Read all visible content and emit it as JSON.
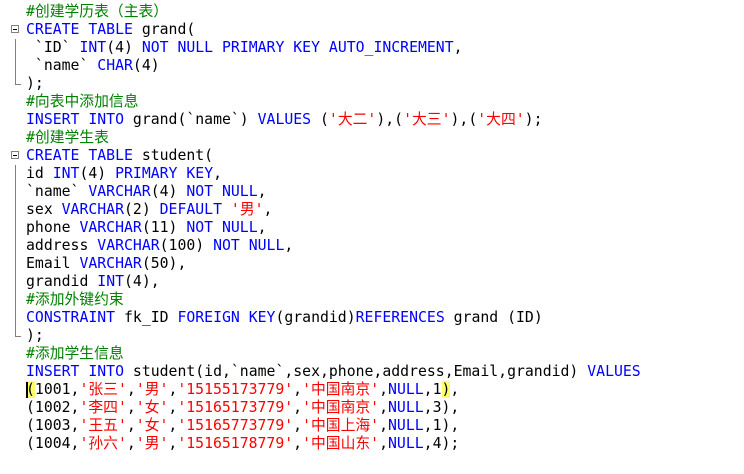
{
  "editor": {
    "language": "SQL",
    "colors": {
      "keyword": "#0000ff",
      "string": "#ff0000",
      "comment": "#008000",
      "text": "#000000"
    },
    "lines": [
      {
        "fold": "",
        "tokens": [
          {
            "t": "cmt",
            "v": "#创建学历表（主表）"
          }
        ]
      },
      {
        "fold": "start",
        "tokens": [
          {
            "t": "kw",
            "v": "CREATE TABLE"
          },
          {
            "t": "pl",
            "v": " grand("
          }
        ]
      },
      {
        "fold": "bar",
        "tokens": [
          {
            "t": "pl",
            "v": " `ID` "
          },
          {
            "t": "kw",
            "v": "INT"
          },
          {
            "t": "pl",
            "v": "(4) "
          },
          {
            "t": "kw",
            "v": "NOT NULL PRIMARY KEY AUTO_INCREMENT"
          },
          {
            "t": "pl",
            "v": ","
          }
        ]
      },
      {
        "fold": "bar",
        "tokens": [
          {
            "t": "pl",
            "v": " `name` "
          },
          {
            "t": "kw",
            "v": "CHAR"
          },
          {
            "t": "pl",
            "v": "(4)"
          }
        ]
      },
      {
        "fold": "end",
        "tokens": [
          {
            "t": "pl",
            "v": ");"
          }
        ]
      },
      {
        "fold": "",
        "tokens": [
          {
            "t": "cmt",
            "v": "#向表中添加信息"
          }
        ]
      },
      {
        "fold": "",
        "tokens": [
          {
            "t": "kw",
            "v": "INSERT INTO"
          },
          {
            "t": "pl",
            "v": " grand(`name`) "
          },
          {
            "t": "kw",
            "v": "VALUES"
          },
          {
            "t": "pl",
            "v": " ("
          },
          {
            "t": "str",
            "v": "'大二'"
          },
          {
            "t": "pl",
            "v": "),("
          },
          {
            "t": "str",
            "v": "'大三'"
          },
          {
            "t": "pl",
            "v": "),("
          },
          {
            "t": "str",
            "v": "'大四'"
          },
          {
            "t": "pl",
            "v": ");"
          }
        ]
      },
      {
        "fold": "",
        "tokens": [
          {
            "t": "cmt",
            "v": "#创建学生表"
          }
        ]
      },
      {
        "fold": "start",
        "tokens": [
          {
            "t": "kw",
            "v": "CREATE TABLE"
          },
          {
            "t": "pl",
            "v": " student("
          }
        ]
      },
      {
        "fold": "bar",
        "tokens": [
          {
            "t": "pl",
            "v": "id "
          },
          {
            "t": "kw",
            "v": "INT"
          },
          {
            "t": "pl",
            "v": "(4) "
          },
          {
            "t": "kw",
            "v": "PRIMARY KEY"
          },
          {
            "t": "pl",
            "v": ","
          }
        ]
      },
      {
        "fold": "bar",
        "tokens": [
          {
            "t": "pl",
            "v": "`name` "
          },
          {
            "t": "kw",
            "v": "VARCHAR"
          },
          {
            "t": "pl",
            "v": "(4) "
          },
          {
            "t": "kw",
            "v": "NOT NULL"
          },
          {
            "t": "pl",
            "v": ","
          }
        ]
      },
      {
        "fold": "bar",
        "tokens": [
          {
            "t": "pl",
            "v": "sex "
          },
          {
            "t": "kw",
            "v": "VARCHAR"
          },
          {
            "t": "pl",
            "v": "(2) "
          },
          {
            "t": "kw",
            "v": "DEFAULT"
          },
          {
            "t": "pl",
            "v": " "
          },
          {
            "t": "str",
            "v": "'男'"
          },
          {
            "t": "pl",
            "v": ","
          }
        ]
      },
      {
        "fold": "bar",
        "tokens": [
          {
            "t": "pl",
            "v": "phone "
          },
          {
            "t": "kw",
            "v": "VARCHAR"
          },
          {
            "t": "pl",
            "v": "(11) "
          },
          {
            "t": "kw",
            "v": "NOT NULL"
          },
          {
            "t": "pl",
            "v": ","
          }
        ]
      },
      {
        "fold": "bar",
        "tokens": [
          {
            "t": "pl",
            "v": "address "
          },
          {
            "t": "kw",
            "v": "VARCHAR"
          },
          {
            "t": "pl",
            "v": "(100) "
          },
          {
            "t": "kw",
            "v": "NOT NULL"
          },
          {
            "t": "pl",
            "v": ","
          }
        ]
      },
      {
        "fold": "bar",
        "tokens": [
          {
            "t": "pl",
            "v": "Email "
          },
          {
            "t": "kw",
            "v": "VARCHAR"
          },
          {
            "t": "pl",
            "v": "(50),"
          }
        ]
      },
      {
        "fold": "bar",
        "tokens": [
          {
            "t": "pl",
            "v": "grandid "
          },
          {
            "t": "kw",
            "v": "INT"
          },
          {
            "t": "pl",
            "v": "(4),"
          }
        ]
      },
      {
        "fold": "bar",
        "tokens": [
          {
            "t": "cmt",
            "v": "#添加外键约束"
          }
        ]
      },
      {
        "fold": "bar",
        "tokens": [
          {
            "t": "kw",
            "v": "CONSTRAINT"
          },
          {
            "t": "pl",
            "v": " fk_ID "
          },
          {
            "t": "kw",
            "v": "FOREIGN KEY"
          },
          {
            "t": "pl",
            "v": "(grandid)"
          },
          {
            "t": "kw",
            "v": "REFERENCES"
          },
          {
            "t": "pl",
            "v": " grand (ID)"
          }
        ]
      },
      {
        "fold": "end",
        "tokens": [
          {
            "t": "pl",
            "v": ");"
          }
        ]
      },
      {
        "fold": "",
        "tokens": [
          {
            "t": "cmt",
            "v": "#添加学生信息"
          }
        ]
      },
      {
        "fold": "",
        "tokens": [
          {
            "t": "kw",
            "v": "INSERT INTO"
          },
          {
            "t": "pl",
            "v": " student(id,`name`,sex,phone,address,Email,grandid) "
          },
          {
            "t": "kw",
            "v": "VALUES"
          }
        ]
      },
      {
        "fold": "",
        "tokens": [
          {
            "t": "hl",
            "v": "("
          },
          {
            "t": "pl",
            "v": "1001,"
          },
          {
            "t": "str",
            "v": "'张三'"
          },
          {
            "t": "pl",
            "v": ","
          },
          {
            "t": "str",
            "v": "'男'"
          },
          {
            "t": "pl",
            "v": ","
          },
          {
            "t": "str",
            "v": "'15155173779'"
          },
          {
            "t": "pl",
            "v": ","
          },
          {
            "t": "str",
            "v": "'中国南京'"
          },
          {
            "t": "pl",
            "v": ","
          },
          {
            "t": "kw",
            "v": "NULL"
          },
          {
            "t": "pl",
            "v": ",1"
          },
          {
            "t": "hl",
            "v": ")"
          },
          {
            "t": "pl",
            "v": ","
          }
        ]
      },
      {
        "fold": "",
        "tokens": [
          {
            "t": "pl",
            "v": "(1002,"
          },
          {
            "t": "str",
            "v": "'李四'"
          },
          {
            "t": "pl",
            "v": ","
          },
          {
            "t": "str",
            "v": "'女'"
          },
          {
            "t": "pl",
            "v": ","
          },
          {
            "t": "str",
            "v": "'15165173779'"
          },
          {
            "t": "pl",
            "v": ","
          },
          {
            "t": "str",
            "v": "'中国南京'"
          },
          {
            "t": "pl",
            "v": ","
          },
          {
            "t": "kw",
            "v": "NULL"
          },
          {
            "t": "pl",
            "v": ",3),"
          }
        ]
      },
      {
        "fold": "",
        "tokens": [
          {
            "t": "pl",
            "v": "(1003,"
          },
          {
            "t": "str",
            "v": "'王五'"
          },
          {
            "t": "pl",
            "v": ","
          },
          {
            "t": "str",
            "v": "'女'"
          },
          {
            "t": "pl",
            "v": ","
          },
          {
            "t": "str",
            "v": "'15165773779'"
          },
          {
            "t": "pl",
            "v": ","
          },
          {
            "t": "str",
            "v": "'中国上海'"
          },
          {
            "t": "pl",
            "v": ","
          },
          {
            "t": "kw",
            "v": "NULL"
          },
          {
            "t": "pl",
            "v": ",1),"
          }
        ]
      },
      {
        "fold": "",
        "tokens": [
          {
            "t": "pl",
            "v": "(1004,"
          },
          {
            "t": "str",
            "v": "'孙六'"
          },
          {
            "t": "pl",
            "v": ","
          },
          {
            "t": "str",
            "v": "'男'"
          },
          {
            "t": "pl",
            "v": ","
          },
          {
            "t": "str",
            "v": "'15165178779'"
          },
          {
            "t": "pl",
            "v": ","
          },
          {
            "t": "str",
            "v": "'中国山东'"
          },
          {
            "t": "pl",
            "v": ","
          },
          {
            "t": "kw",
            "v": "NULL"
          },
          {
            "t": "pl",
            "v": ",4);"
          }
        ]
      }
    ]
  }
}
